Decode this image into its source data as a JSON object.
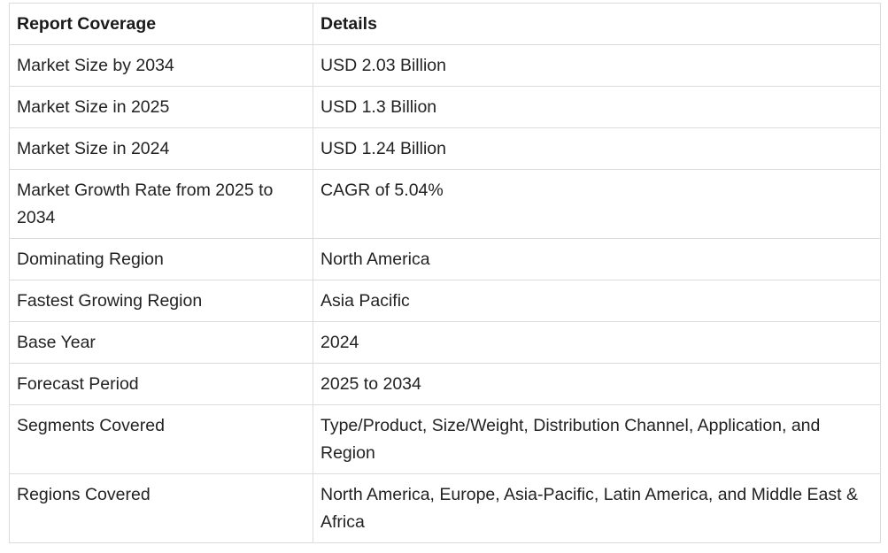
{
  "table": {
    "headers": [
      "Report Coverage",
      "Details"
    ],
    "rows": [
      [
        "Market Size by 2034",
        "USD 2.03 Billion"
      ],
      [
        "Market Size in 2025",
        "USD 1.3 Billion"
      ],
      [
        "Market Size in 2024",
        "USD 1.24 Billion"
      ],
      [
        "Market Growth Rate from 2025 to 2034",
        "CAGR of 5.04%"
      ],
      [
        "Dominating Region",
        "North America"
      ],
      [
        "Fastest Growing Region",
        "Asia Pacific"
      ],
      [
        "Base Year",
        "2024"
      ],
      [
        "Forecast Period",
        "2025 to 2034"
      ],
      [
        "Segments Covered",
        "Type/Product, Size/Weight, Distribution Channel, Application, and Region"
      ],
      [
        "Regions Covered",
        "North America, Europe, Asia-Pacific, Latin America, and Middle East & Africa"
      ]
    ]
  }
}
